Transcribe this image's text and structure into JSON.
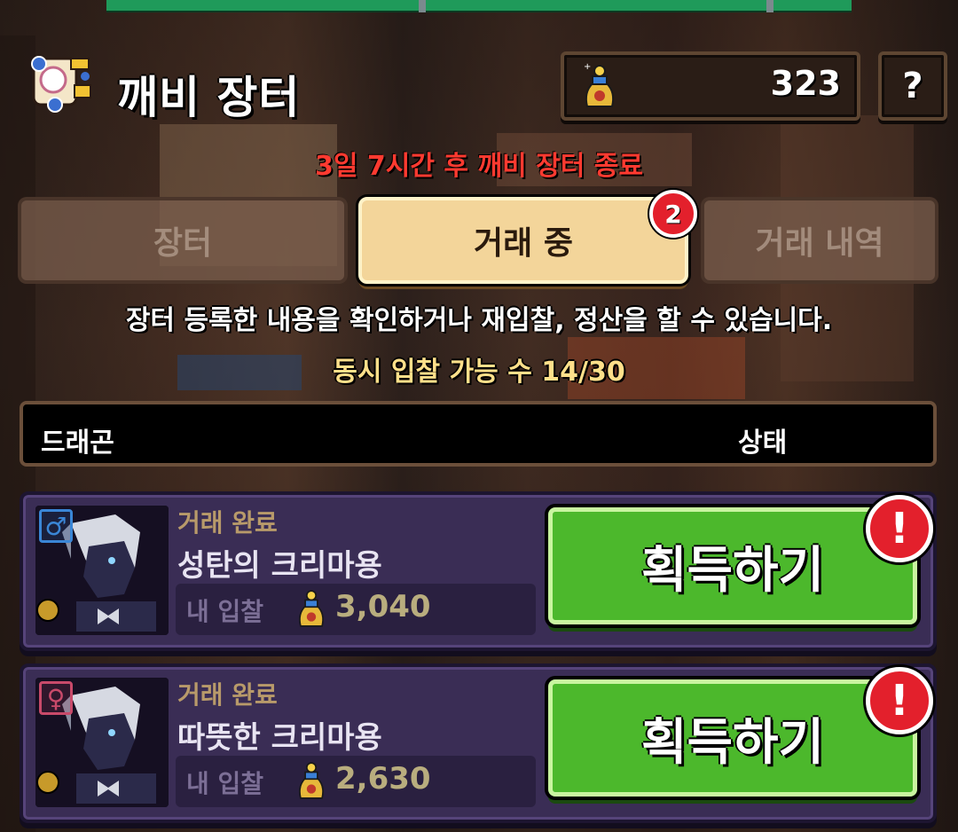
{
  "header": {
    "title": "깨비 장터",
    "currency_value": "323",
    "help_label": "?"
  },
  "timer_text": "3일 7시간 후 깨비 장터 종료",
  "tabs": [
    {
      "label": "장터",
      "active": false
    },
    {
      "label": "거래 중",
      "active": true,
      "badge": "2"
    },
    {
      "label": "거래 내역",
      "active": false
    }
  ],
  "info": {
    "description": "장터 등록한 내용을 확인하거나 재입찰, 정산을 할 수 있습니다.",
    "bid_count": "동시 입찰 가능 수 14/30"
  },
  "table": {
    "col_left": "드래곤",
    "col_right": "상태"
  },
  "items": [
    {
      "gender": "male",
      "gender_glyph": "♂",
      "status": "거래 완료",
      "name": "성탄의 크리마용",
      "bid_label": "내 입찰",
      "bid_value": "3,040",
      "button_label": "획득하기",
      "alert": "!"
    },
    {
      "gender": "female",
      "gender_glyph": "♀",
      "status": "거래 완료",
      "name": "따뜻한 크리마용",
      "bid_label": "내 입찰",
      "bid_value": "2,630",
      "button_label": "획득하기",
      "alert": "!"
    }
  ],
  "colors": {
    "timer_red": "#ff3a30",
    "button_green": "#4cb82c",
    "active_tab": "#f3d59a",
    "row_purple": "#3a2d55"
  }
}
